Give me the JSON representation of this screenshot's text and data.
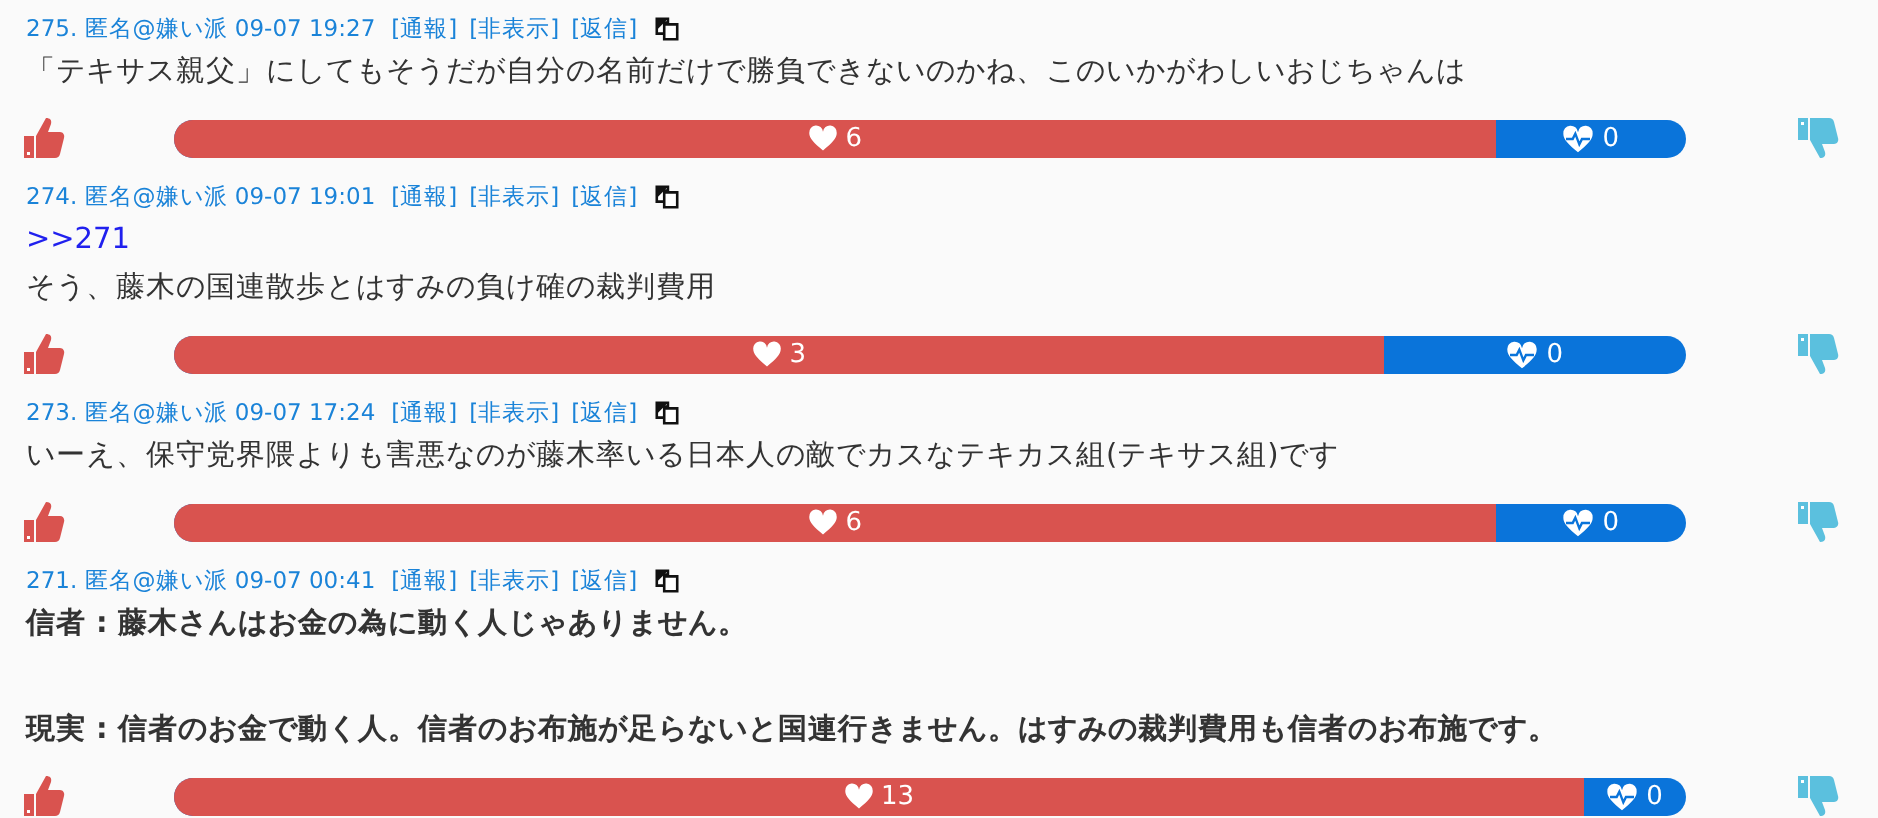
{
  "comments": [
    {
      "meta": "275. 匿名@嫌い派 09-07 19:27",
      "links": [
        "[通報]",
        "[非表示]",
        "[返信]"
      ],
      "bold": false,
      "lines": [
        {
          "kind": "text",
          "text": "「テキサス親父」にしてもそうだが自分の名前だけで勝負できないのかね、このいかがわしいおじちゃんは"
        }
      ],
      "likes": "6",
      "dislikes": "0",
      "level": 0.874
    },
    {
      "meta": "274. 匿名@嫌い派 09-07 19:01",
      "links": [
        "[通報]",
        "[非表示]",
        "[返信]"
      ],
      "bold": false,
      "lines": [
        {
          "kind": "anchor",
          "text": ">>271"
        },
        {
          "kind": "text",
          "text": "そう、藤木の国連散歩とはすみの負け確の裁判費用"
        }
      ],
      "likes": "3",
      "dislikes": "0",
      "level": 0.8
    },
    {
      "meta": "273. 匿名@嫌い派 09-07 17:24",
      "links": [
        "[通報]",
        "[非表示]",
        "[返信]"
      ],
      "bold": false,
      "lines": [
        {
          "kind": "text",
          "text": "いーえ、保守党界隈よりも害悪なのが藤木率いる日本人の敵でカスなテキカス組(テキサス組)です"
        }
      ],
      "likes": "6",
      "dislikes": "0",
      "level": 0.874
    },
    {
      "meta": "271. 匿名@嫌い派 09-07 00:41",
      "links": [
        "[通報]",
        "[非表示]",
        "[返信]"
      ],
      "bold": true,
      "lines": [
        {
          "kind": "text",
          "text": "信者 : 藤木さんはお金の為に動く人じゃありません。"
        },
        {
          "kind": "gap-text",
          "text": "現実 : 信者のお金で動く人。信者のお布施が足らないと国連行きません。はすみの裁判費用も信者のお布施です。"
        }
      ],
      "likes": "13",
      "dislikes": "0",
      "level": 0.932
    }
  ]
}
